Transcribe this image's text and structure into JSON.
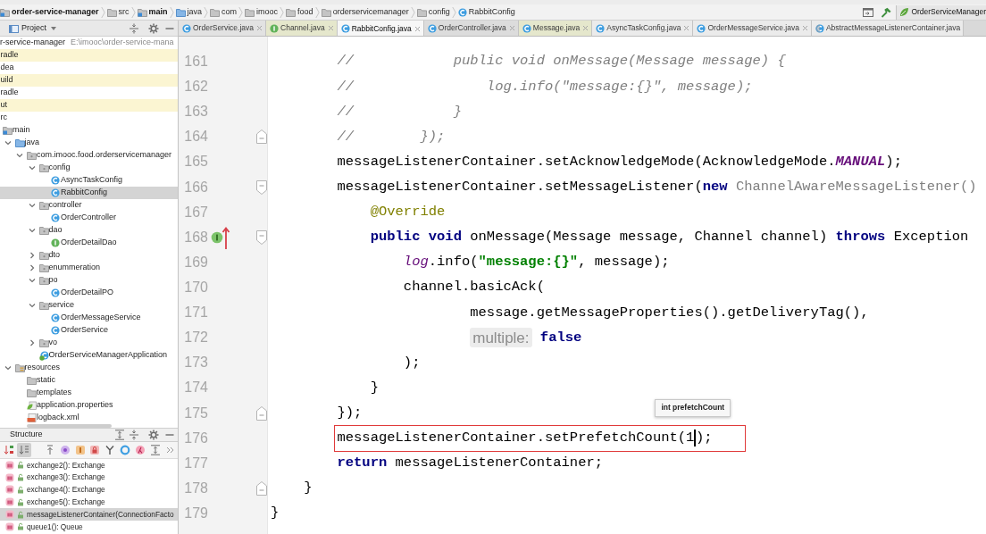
{
  "navigation_bar": {
    "items": [
      {
        "label": "order-service-manager",
        "kind": "module"
      },
      {
        "label": "src",
        "kind": "folder"
      },
      {
        "label": "main",
        "kind": "module"
      },
      {
        "label": "java",
        "kind": "source-folder"
      },
      {
        "label": "com",
        "kind": "folder"
      },
      {
        "label": "imooc",
        "kind": "folder"
      },
      {
        "label": "food",
        "kind": "folder"
      },
      {
        "label": "orderservicemanager",
        "kind": "folder"
      },
      {
        "label": "config",
        "kind": "folder"
      },
      {
        "label": "RabbitConfig",
        "kind": "class"
      }
    ],
    "run_configuration": "OrderServiceManager"
  },
  "project_panel": {
    "title": "Project",
    "tree": [
      {
        "label": "r-service-manager",
        "path": "E:\\imooc\\order-service-mana",
        "selected": false,
        "children": [
          {
            "label": "radle",
            "selected": false,
            "highlighted": true
          },
          {
            "label": "dea",
            "selected": false,
            "highlighted": false
          },
          {
            "label": "uild",
            "selected": false,
            "highlighted": true
          },
          {
            "label": "radle",
            "selected": false,
            "highlighted": false
          },
          {
            "label": "ut",
            "selected": false,
            "highlighted": true
          },
          {
            "label": "rc",
            "selected": false,
            "highlighted": false,
            "children": [
              {
                "label": "main",
                "kind": "module",
                "selected": false,
                "children": [
                  {
                    "label": "java",
                    "kind": "source-folder",
                    "expanded": true,
                    "selected": false,
                    "children": [
                      {
                        "label": "com.imooc.food.orderservicemanager",
                        "kind": "package",
                        "expanded": true,
                        "selected": false,
                        "children": [
                          {
                            "label": "config",
                            "kind": "package",
                            "expanded": true,
                            "selected": false,
                            "children": [
                              {
                                "label": "AsyncTaskConfig",
                                "kind": "class",
                                "selected": false
                              },
                              {
                                "label": "RabbitConfig",
                                "kind": "class",
                                "selected": true
                              }
                            ]
                          },
                          {
                            "label": "controller",
                            "kind": "package",
                            "expanded": true,
                            "selected": false,
                            "children": [
                              {
                                "label": "OrderController",
                                "kind": "class",
                                "selected": false
                              }
                            ]
                          },
                          {
                            "label": "dao",
                            "kind": "package",
                            "expanded": true,
                            "selected": false,
                            "children": [
                              {
                                "label": "OrderDetailDao",
                                "kind": "interface",
                                "selected": false
                              }
                            ]
                          },
                          {
                            "label": "dto",
                            "kind": "package",
                            "expanded": false,
                            "selected": false
                          },
                          {
                            "label": "enummeration",
                            "kind": "package",
                            "expanded": false,
                            "selected": false
                          },
                          {
                            "label": "po",
                            "kind": "package",
                            "expanded": true,
                            "selected": false,
                            "children": [
                              {
                                "label": "OrderDetailPO",
                                "kind": "class",
                                "selected": false
                              }
                            ]
                          },
                          {
                            "label": "service",
                            "kind": "package",
                            "expanded": true,
                            "selected": false,
                            "children": [
                              {
                                "label": "OrderMessageService",
                                "kind": "class",
                                "selected": false
                              },
                              {
                                "label": "OrderService",
                                "kind": "class",
                                "selected": false
                              }
                            ]
                          },
                          {
                            "label": "vo",
                            "kind": "package",
                            "expanded": false,
                            "selected": false
                          },
                          {
                            "label": "OrderServiceManagerApplication",
                            "kind": "spring-app",
                            "selected": false
                          }
                        ]
                      }
                    ]
                  },
                  {
                    "label": "resources",
                    "kind": "resources-folder",
                    "expanded": true,
                    "selected": false,
                    "children": [
                      {
                        "label": "static",
                        "kind": "folder",
                        "selected": false
                      },
                      {
                        "label": "templates",
                        "kind": "folder",
                        "selected": false
                      },
                      {
                        "label": "application.properties",
                        "kind": "properties",
                        "selected": false
                      },
                      {
                        "label": "logback.xml",
                        "kind": "xml",
                        "selected": false
                      }
                    ]
                  }
                ]
              }
            ]
          }
        ]
      }
    ]
  },
  "structure_panel": {
    "title": "Structure",
    "toolbar": [
      {
        "kind": "sort-alpha",
        "on": false
      },
      {
        "kind": "sort-visibility",
        "on": true
      },
      {
        "kind": "inherited",
        "on": false
      },
      {
        "kind": "properties",
        "on": false
      },
      {
        "kind": "fields",
        "on": false
      },
      {
        "kind": "non-public",
        "on": false
      },
      {
        "kind": "hierarchy",
        "on": false
      },
      {
        "kind": "anonymous",
        "on": false
      },
      {
        "kind": "lambdas",
        "on": false
      },
      {
        "kind": "expand",
        "on": false
      },
      {
        "kind": "more",
        "on": false
      }
    ],
    "items": [
      {
        "label": "exchange2(): Exchange",
        "selected": false
      },
      {
        "label": "exchange3(): Exchange",
        "selected": false
      },
      {
        "label": "exchange4(): Exchange",
        "selected": false
      },
      {
        "label": "exchange5(): Exchange",
        "selected": false
      },
      {
        "label": "messageListenerContainer(ConnectionFacto",
        "selected": true
      },
      {
        "label": "queue1(): Queue",
        "selected": false
      }
    ]
  },
  "editor": {
    "tabs": [
      {
        "label": "OrderService.java",
        "kind": "class",
        "color": "#e2e2e2",
        "selected": false,
        "close_button": true
      },
      {
        "label": "Channel.java",
        "kind": "interface",
        "color": "#e5e7cc",
        "selected": false,
        "close_button": true
      },
      {
        "label": "RabbitConfig.java",
        "kind": "class",
        "color": "#f7f7f7",
        "selected": true,
        "close_button": true
      },
      {
        "label": "OrderController.java",
        "kind": "class",
        "color": "#dcdcdc",
        "selected": false,
        "close_button": true
      },
      {
        "label": "Message.java",
        "kind": "class",
        "color": "#e5e7cc",
        "selected": false,
        "close_button": true
      },
      {
        "label": "AsyncTaskConfig.java",
        "kind": "class",
        "color": "#ebebeb",
        "selected": false,
        "close_button": true
      },
      {
        "label": "OrderMessageService.java",
        "kind": "class",
        "color": "#ebebeb",
        "selected": false,
        "close_button": true
      },
      {
        "label": "AbstractMessageListenerContainer.java",
        "kind": "abstract-class",
        "color": "#ebebeb",
        "selected": false,
        "close_button": false
      }
    ],
    "lines": [
      {
        "number": "161",
        "tokens": [
          {
            "text": "        //            public void onMessage(Message message) {",
            "kind": "comment"
          }
        ]
      },
      {
        "number": "162",
        "tokens": [
          {
            "text": "        //                log.info(\"message:{}\", message);",
            "kind": "comment"
          }
        ]
      },
      {
        "number": "163",
        "tokens": [
          {
            "text": "        //            }",
            "kind": "comment"
          }
        ]
      },
      {
        "number": "164",
        "tokens": [
          {
            "text": "        //        });",
            "kind": "comment"
          }
        ],
        "fold": {
          "kind": "end"
        }
      },
      {
        "number": "165",
        "tokens": [
          {
            "text": "        messageListenerContainer.setAcknowledgeMode(AcknowledgeMode.",
            "kind": "plain"
          },
          {
            "text": "MANUAL",
            "kind": "constant"
          },
          {
            "text": ");",
            "kind": "plain"
          }
        ]
      },
      {
        "number": "166",
        "tokens": [
          {
            "text": "        messageListenerContainer.setMessageListener(",
            "kind": "plain"
          },
          {
            "text": "new",
            "kind": "keyword"
          },
          {
            "text": " ChannelAwareMessageListener()",
            "kind": "unused"
          }
        ],
        "fold": {
          "kind": "start"
        }
      },
      {
        "number": "167",
        "tokens": [
          {
            "text": "            @Override",
            "kind": "annotation"
          }
        ]
      },
      {
        "number": "168",
        "tokens": [
          {
            "text": "            public void",
            "kind": "keyword"
          },
          {
            "text": " onMessage(Message message, Channel channel) ",
            "kind": "plain"
          },
          {
            "text": "throws",
            "kind": "keyword"
          },
          {
            "text": " Exception",
            "kind": "plain"
          }
        ],
        "gutter_marker": {
          "kind": "implements"
        },
        "fold": {
          "kind": "start"
        }
      },
      {
        "number": "169",
        "tokens": [
          {
            "text": "                log",
            "kind": "static"
          },
          {
            "text": ".info(",
            "kind": "plain"
          },
          {
            "text": "\"message:{}\"",
            "kind": "string"
          },
          {
            "text": ", message);",
            "kind": "plain"
          }
        ]
      },
      {
        "number": "170",
        "tokens": [
          {
            "text": "                channel.basicAck(",
            "kind": "plain"
          }
        ]
      },
      {
        "number": "171",
        "tokens": [
          {
            "text": "                        message.getMessageProperties().getDeliveryTag(),",
            "kind": "plain"
          }
        ]
      },
      {
        "number": "172",
        "tokens": [
          {
            "text": "                        multiple:",
            "kind": "hint"
          },
          {
            "text": "false",
            "kind": "keyword"
          }
        ]
      },
      {
        "number": "173",
        "tokens": [
          {
            "text": "                );",
            "kind": "plain"
          }
        ]
      },
      {
        "number": "174",
        "tokens": [
          {
            "text": "            }",
            "kind": "plain"
          }
        ]
      },
      {
        "number": "175",
        "tokens": [
          {
            "text": "        });",
            "kind": "plain"
          }
        ],
        "fold": {
          "kind": "end"
        }
      },
      {
        "number": "176",
        "tokens": [
          {
            "text": "        messageListenerContainer.setPrefetchCount(1",
            "kind": "plain"
          },
          {
            "kind": "caret"
          },
          {
            "text": ");",
            "kind": "plain"
          }
        ],
        "boxed": true,
        "tooltip": "int prefetchCount"
      },
      {
        "number": "177",
        "tokens": [
          {
            "text": "        return",
            "kind": "keyword"
          },
          {
            "text": " messageListenerContainer;",
            "kind": "plain"
          }
        ]
      },
      {
        "number": "178",
        "tokens": [
          {
            "text": "    }",
            "kind": "plain"
          }
        ],
        "fold": {
          "kind": "end"
        }
      },
      {
        "number": "179",
        "tokens": [
          {
            "text": "}",
            "kind": "plain"
          }
        ]
      }
    ]
  }
}
